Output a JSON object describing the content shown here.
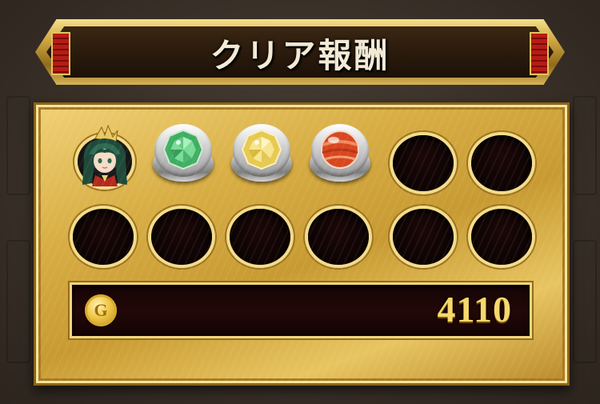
{
  "header": {
    "title": "クリア報酬"
  },
  "rewards": {
    "items": [
      {
        "kind": "character-portrait",
        "icon": "character-portrait-icon"
      },
      {
        "kind": "gem",
        "icon": "green-gem-icon",
        "color": "#5ccf7e"
      },
      {
        "kind": "gem",
        "icon": "yellow-gem-icon",
        "color": "#f2e27a"
      },
      {
        "kind": "orb",
        "icon": "orange-orb-icon",
        "color": "#e2552c"
      }
    ],
    "empty_slot_count": 8
  },
  "coins": {
    "icon": "gold-coin-icon",
    "coin_letter": "G",
    "amount": "4110"
  },
  "colors": {
    "panel_gold": "#d8ae45",
    "banner_dark": "#2a1a0c",
    "accent_red": "#b51d16",
    "amount_gold": "#f6d86b"
  }
}
